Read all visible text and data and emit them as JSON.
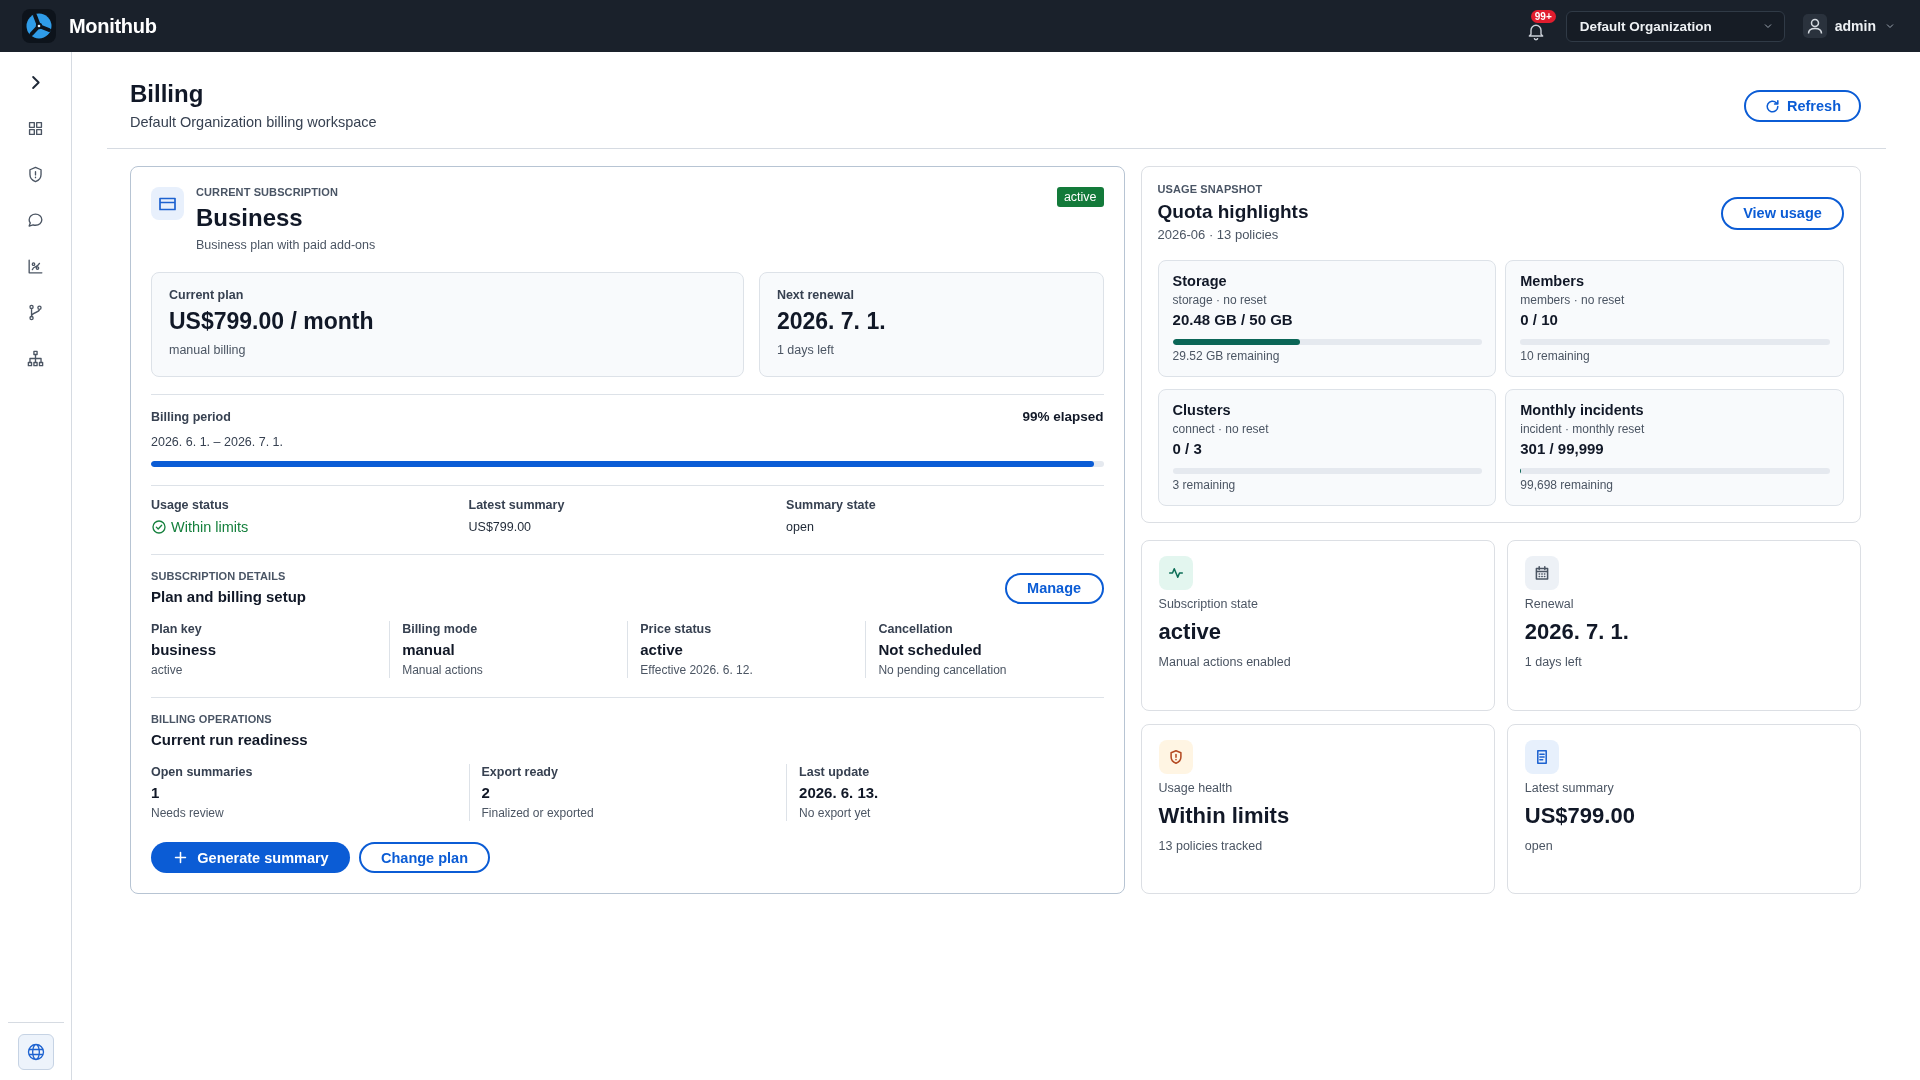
{
  "topbar": {
    "brand": "Monithub",
    "notification_badge": "99+",
    "organization_select": {
      "value": "Default Organization"
    },
    "user_menu": {
      "name": "admin"
    }
  },
  "page_header": {
    "title": "Billing",
    "subtitle": "Default Organization billing workspace",
    "refresh_button": "Refresh"
  },
  "subscription_card": {
    "caption": "CURRENT SUBSCRIPTION",
    "plan_name": "Business",
    "description": "Business plan with paid add-ons",
    "status_badge": "active",
    "summary_boxes": [
      {
        "label": "Current plan",
        "value": "US$799.00 / month",
        "note": "manual billing"
      },
      {
        "label": "Next renewal",
        "value": "2026. 7. 1.",
        "note": "1 days left"
      }
    ],
    "billing_period": {
      "label": "Billing period",
      "elapsed": "99% elapsed",
      "range": "2026. 6. 1. – 2026. 7. 1.",
      "level": 0.99
    },
    "status_fields": [
      {
        "label": "Usage status",
        "value": "Within limits",
        "kind": "ok"
      },
      {
        "label": "Latest summary",
        "value": "US$799.00",
        "kind": "plain"
      },
      {
        "label": "Summary state",
        "value": "open",
        "kind": "plain"
      }
    ],
    "details": {
      "caption": "SUBSCRIPTION DETAILS",
      "title": "Plan and billing setup",
      "action_button": "Manage",
      "fields": [
        {
          "label": "Plan key",
          "value": "business",
          "note": "active"
        },
        {
          "label": "Billing mode",
          "value": "manual",
          "note": "Manual actions"
        },
        {
          "label": "Price status",
          "value": "active",
          "note": "Effective 2026. 6. 12."
        },
        {
          "label": "Cancellation",
          "value": "Not scheduled",
          "note": "No pending cancellation"
        }
      ]
    },
    "operations": {
      "caption": "BILLING OPERATIONS",
      "title": "Current run readiness",
      "fields": [
        {
          "label": "Open summaries",
          "value": "1",
          "note": "Needs review"
        },
        {
          "label": "Export ready",
          "value": "2",
          "note": "Finalized or exported"
        },
        {
          "label": "Last update",
          "value": "2026. 6. 13.",
          "note": "No export yet"
        }
      ],
      "buttons": [
        {
          "label": "Generate summary",
          "kind": "primary"
        },
        {
          "label": "Change plan",
          "kind": "secondary"
        }
      ]
    }
  },
  "usage_snapshot": {
    "caption": "USAGE SNAPSHOT",
    "title": "Quota highlights",
    "meta": "2026-06 · 13 policies",
    "action_button": "View usage",
    "quotas": [
      {
        "name": "Storage",
        "meta": "storage · no reset",
        "usage": "20.48 GB / 50 GB",
        "level": 0.41,
        "remaining": "29.52 GB remaining"
      },
      {
        "name": "Members",
        "meta": "members · no reset",
        "usage": "0 / 10",
        "remaining": "10 remaining"
      },
      {
        "name": "Clusters",
        "meta": "connect · no reset",
        "usage": "0 / 3",
        "remaining": "3 remaining"
      },
      {
        "name": "Monthly incidents",
        "meta": "incident · monthly reset",
        "usage": "301 / 99,999",
        "level": 0.003,
        "remaining": "99,698 remaining"
      }
    ]
  },
  "stat_cards": [
    {
      "kind": "pulse",
      "label": "Subscription state",
      "value": "active",
      "note": "Manual actions enabled"
    },
    {
      "kind": "calendar",
      "label": "Renewal",
      "value": "2026. 7. 1.",
      "note": "1 days left"
    },
    {
      "kind": "shield",
      "label": "Usage health",
      "value": "Within limits",
      "note": "13 policies tracked"
    },
    {
      "kind": "document",
      "label": "Latest summary",
      "value": "US$799.00",
      "note": "open"
    }
  ]
}
